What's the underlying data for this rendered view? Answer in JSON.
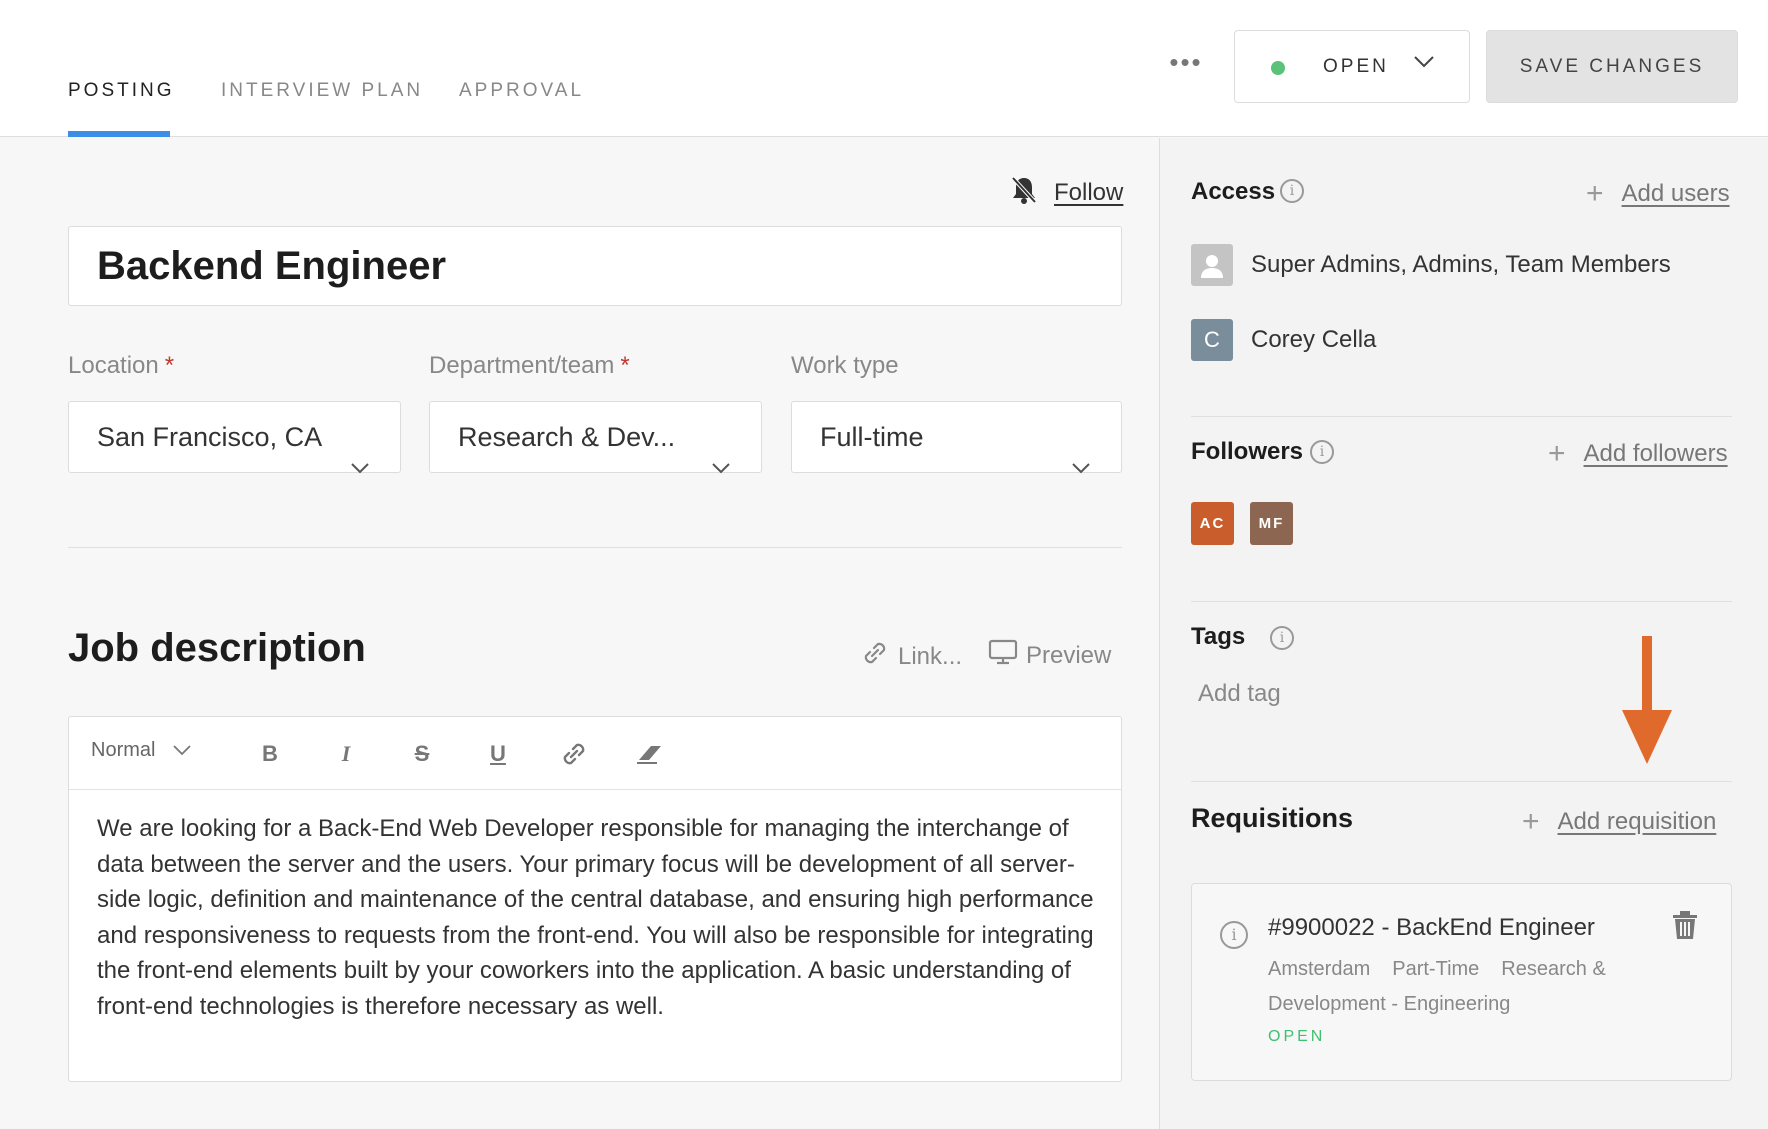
{
  "tabs": [
    {
      "label": "POSTING",
      "active": true
    },
    {
      "label": "INTERVIEW PLAN",
      "active": false
    },
    {
      "label": "APPROVAL",
      "active": false
    }
  ],
  "header": {
    "more_label": "•••",
    "status": {
      "label": "OPEN",
      "color": "#5ac27a"
    },
    "save_label": "SAVE CHANGES"
  },
  "posting": {
    "follow_label": "Follow",
    "title": "Backend Engineer",
    "fields": {
      "location": {
        "label": "Location",
        "required": "*",
        "value": "San Francisco, CA"
      },
      "department": {
        "label": "Department/team",
        "required": "*",
        "value": "Research & Dev..."
      },
      "work_type": {
        "label": "Work type",
        "value": "Full-time"
      }
    },
    "job_description": {
      "heading": "Job description",
      "link_label": "Link...",
      "preview_label": "Preview",
      "format_select": "Normal",
      "body": "We are looking for a Back-End Web Developer responsible for managing the interchange of data between the server and the users. Your primary focus will be development of all server-side logic, definition and maintenance of the central database, and ensuring high performance and responsiveness to requests from the front-end. You will also be responsible for integrating the front-end elements built by your coworkers into the application. A basic understanding of front-end technologies is therefore necessary as well."
    }
  },
  "sidebar": {
    "access": {
      "title": "Access",
      "add_label": "Add users",
      "entries": [
        {
          "label": "Super Admins, Admins, Team Members",
          "avatar": "user-icon"
        },
        {
          "label": "Corey Cella",
          "avatar": "C",
          "color": "#7a8d9a"
        }
      ]
    },
    "followers": {
      "title": "Followers",
      "add_label": "Add followers",
      "items": [
        {
          "initials": "AC",
          "color": "#c95e2c"
        },
        {
          "initials": "MF",
          "color": "#8c6650"
        }
      ]
    },
    "tags": {
      "title": "Tags",
      "placeholder": "Add tag",
      "annotation_color": "#e06a2b"
    },
    "requisitions": {
      "title": "Requisitions",
      "add_label": "Add requisition",
      "items": [
        {
          "title": "#9900022 - BackEnd Engineer",
          "location": "Amsterdam",
          "type": "Part-Time",
          "team": "Research & Development - Engineering",
          "status": "OPEN"
        }
      ]
    }
  }
}
